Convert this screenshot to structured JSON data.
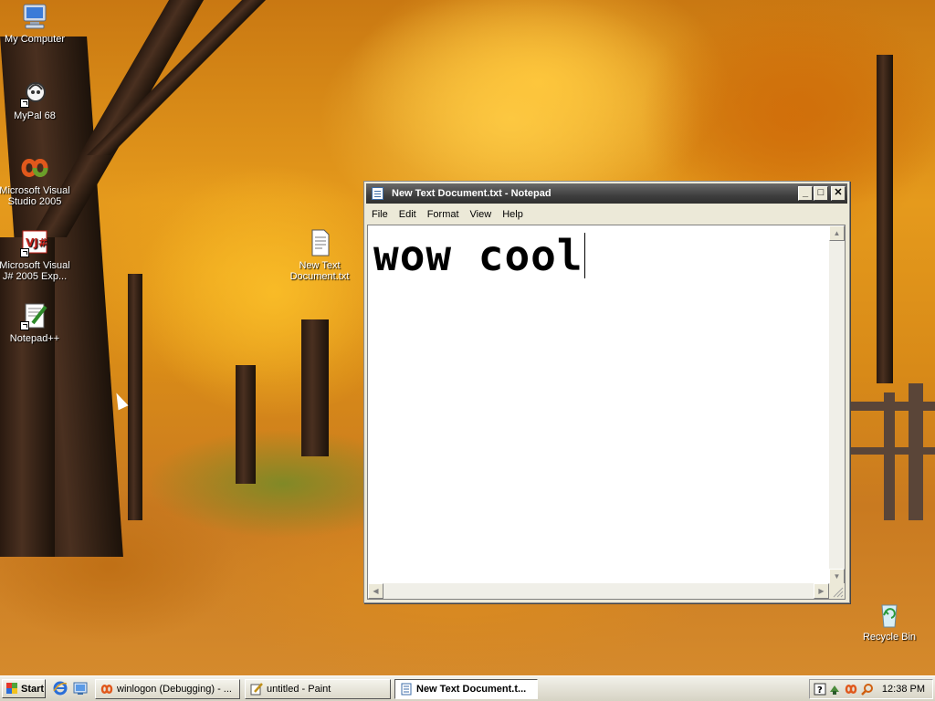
{
  "desktop": {
    "icons": [
      {
        "label": "My Computer",
        "icon": "my-computer-icon"
      },
      {
        "label": "MyPal 68",
        "icon": "mypal-icon"
      },
      {
        "label": "Microsoft Visual Studio 2005",
        "icon": "visual-studio-icon"
      },
      {
        "label": "Microsoft Visual J# 2005 Exp...",
        "icon": "visual-jsharp-icon"
      },
      {
        "label": "Notepad++",
        "icon": "notepadpp-icon"
      },
      {
        "label": "New Text Document.txt",
        "icon": "text-document-icon"
      },
      {
        "label": "Recycle Bin",
        "icon": "recycle-bin-icon"
      }
    ]
  },
  "notepad": {
    "title": "New Text Document.txt - Notepad",
    "menu": [
      "File",
      "Edit",
      "Format",
      "View",
      "Help"
    ],
    "content": "wow cool",
    "caption_buttons": {
      "minimize": "_",
      "maximize": "□",
      "close": "✕"
    }
  },
  "taskbar": {
    "start_label": "Start",
    "quick_launch": [
      "internet-explorer-icon",
      "show-desktop-icon"
    ],
    "tasks": [
      {
        "label": "winlogon (Debugging) - ...",
        "icon": "visual-studio-icon",
        "active": false
      },
      {
        "label": "untitled - Paint",
        "icon": "paint-icon",
        "active": false
      },
      {
        "label": "New Text Document.t...",
        "icon": "notepad-icon",
        "active": true
      }
    ],
    "tray_icons": [
      "help-icon",
      "network-icon",
      "visual-studio-tray-icon",
      "search-icon"
    ],
    "clock": "12:38 PM"
  },
  "colors": {
    "title_bar": "#3f3f3f",
    "desktop_autumn": "#e59a1c",
    "window_face": "#ece9d8"
  }
}
